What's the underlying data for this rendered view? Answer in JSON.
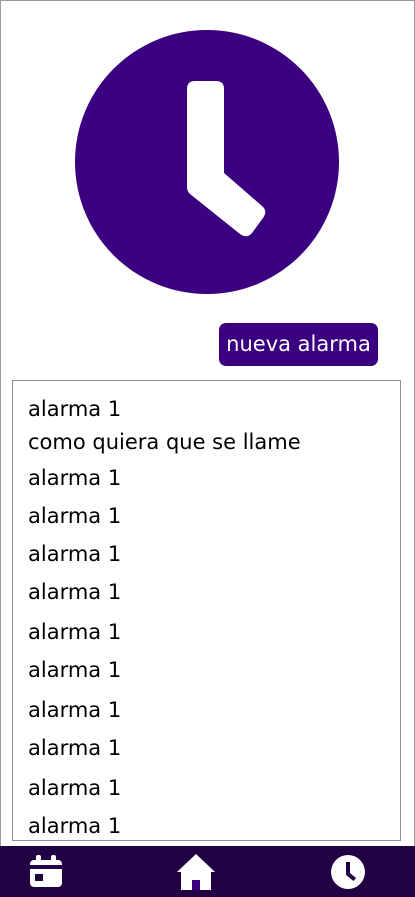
{
  "theme": {
    "accent": "#3a0080",
    "nav_background": "#210044",
    "list_border": "#8f8f8f"
  },
  "hero": {
    "icon": "clock-icon"
  },
  "actions": {
    "new_alarm_label": "nueva alarma"
  },
  "alarms": [
    "alarma 1",
    "como quiera que se llame",
    "alarma 1",
    "alarma 1",
    "alarma 1",
    "alarma 1",
    "alarma 1",
    "alarma 1",
    "alarma 1",
    "alarma 1",
    "alarma 1",
    "alarma 1"
  ],
  "bottom_nav": {
    "items": [
      {
        "icon": "calendar-icon"
      },
      {
        "icon": "home-icon"
      },
      {
        "icon": "clock-icon"
      }
    ]
  }
}
